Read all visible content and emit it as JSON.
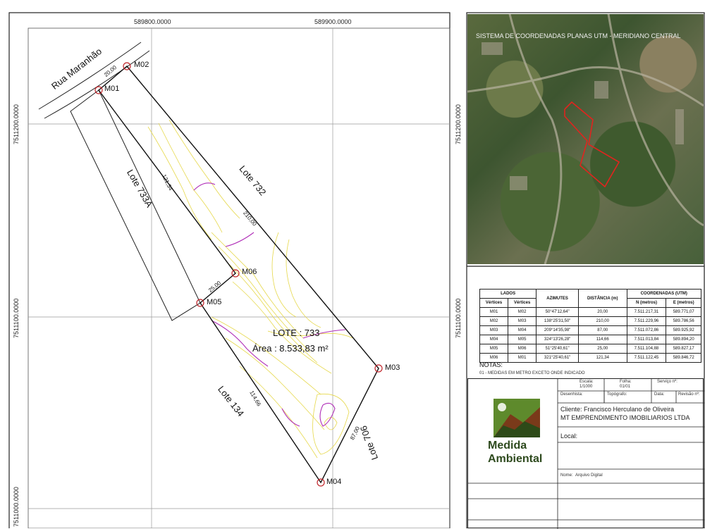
{
  "grid": {
    "top_labels": [
      "589800.0000",
      "589900.0000"
    ],
    "left_labels": [
      "7511200.0000",
      "7511100.0000",
      "7511000.0000"
    ],
    "right_labels": [
      "7511200.0000",
      "7511100.0000"
    ]
  },
  "street": "Rua Maranhão",
  "lots": {
    "lote_733a": "Lote 733A",
    "lote_732": "Lote 732",
    "lote_134": "Lote 134",
    "lote_706": "Lote 706"
  },
  "main_lot": {
    "title": "LOTE : 733",
    "area": "Área : 8.533,83 m²"
  },
  "markers": [
    "M01",
    "M02",
    "M03",
    "M04",
    "M05",
    "M06"
  ],
  "dimensions": {
    "m01_m02": "20,00",
    "m02_m03": "210,00",
    "m03_m04": "87,00",
    "m04_m05": "114,66",
    "m05_m06": "25,00",
    "m06_m01": "121,34"
  },
  "satellite": {
    "header": "SISTEMA DE COORDENADAS PLANAS UTM - MERIDIANO CENTRAL"
  },
  "table": {
    "group_headers": [
      "LADOS",
      "AZIMUTES",
      "DISTÂNCIA (m)",
      "COORDENADAS (UTM)"
    ],
    "sub_headers": [
      "Vértices",
      "Vértices",
      "N (metros)",
      "E (metros)"
    ],
    "rows": [
      [
        "M01",
        "M02",
        "50°47'12,64\"",
        "20,00",
        "7.511.217,31",
        "589.771,07"
      ],
      [
        "M02",
        "M03",
        "138°25'31,50\"",
        "210,00",
        "7.511.229,96",
        "589.786,56"
      ],
      [
        "M03",
        "M04",
        "209°14'35,98\"",
        "87,00",
        "7.511.072,86",
        "589.925,92"
      ],
      [
        "M04",
        "M05",
        "324°13'26,28\"",
        "114,66",
        "7.511.013,84",
        "589.894,20"
      ],
      [
        "M05",
        "M06",
        "51°25'40,61\"",
        "25,00",
        "7.511.104,88",
        "589.827,17"
      ],
      [
        "M06",
        "M01",
        "321°25'40,61\"",
        "121,34",
        "7.511.122,45",
        "589.846,72"
      ]
    ]
  },
  "notes": {
    "title": "NOTAS:",
    "text": "01 - MEDIDAS EM METRO EXCETO ONDE INDICADO"
  },
  "title_block": {
    "escala_label": "Escala:",
    "escala_value": "1/1000",
    "folha_label": "Folha:",
    "folha_value": "01/01",
    "servico_label": "Serviço nº:",
    "desenhista_label": "Desenhista:",
    "topografo_label": "Topógrafo:",
    "data_label": "Data:",
    "revisao_label": "Revisão nº:",
    "cliente": "Cliente:  Francisco Herculano de Oliveira",
    "empresa": "MT EMPRENDIMENTO IMOBILIARIOS LTDA",
    "local_label": "Local:",
    "nome_label": "Nome:",
    "nome_value": "Arquivo Digital"
  },
  "logo": {
    "line1": "Medida",
    "line2": "Ambiental"
  },
  "colors": {
    "contour_yellow": "#e6d84a",
    "contour_purple": "#b02fb8",
    "boundary": "#111111",
    "marker_red": "#c0262b",
    "satellite_outline": "#e0241e"
  }
}
